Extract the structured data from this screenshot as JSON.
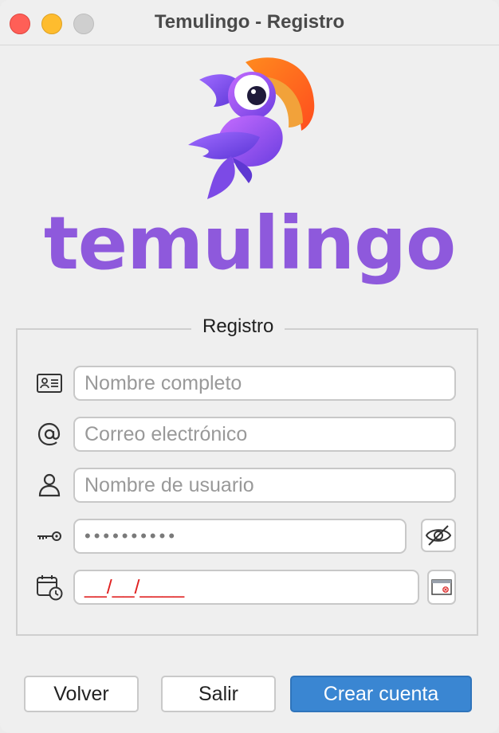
{
  "window": {
    "title": "Temulingo - Registro"
  },
  "brand": {
    "wordmark": "temulingo",
    "logo_icon": "parrot-logo-icon"
  },
  "form": {
    "legend": "Registro",
    "fields": [
      {
        "icon": "id-card-icon",
        "placeholder": "Nombre completo"
      },
      {
        "icon": "at-sign-icon",
        "placeholder": "Correo electrónico"
      },
      {
        "icon": "user-icon",
        "placeholder": "Nombre de usuario"
      },
      {
        "icon": "key-icon",
        "value": "••••••••••"
      },
      {
        "icon": "calendar-clock-icon",
        "value": "__/__/____"
      }
    ],
    "password_toggle_icon": "eye-slash-icon",
    "date_picker_icon": "calendar-picker-icon"
  },
  "actions": {
    "back_label": "Volver",
    "exit_label": "Salir",
    "create_label": "Crear cuenta"
  },
  "colors": {
    "primary_button": "#3a86d2",
    "wordmark": "#8e59dc",
    "date_mask": "#e02020"
  }
}
